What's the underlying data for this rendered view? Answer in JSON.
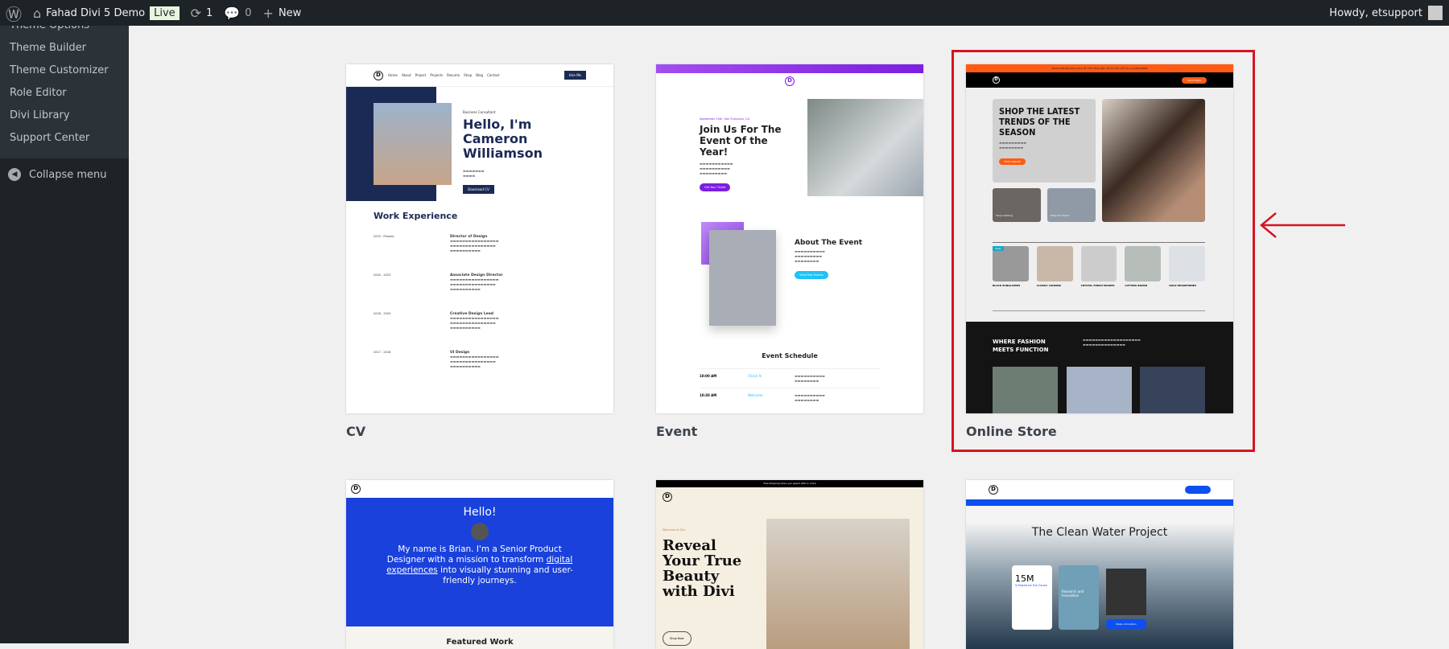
{
  "topbar": {
    "site_name": "Fahad Divi 5 Demo",
    "live_badge": "Live",
    "updates_count": "1",
    "comments_count": "0",
    "new_label": "New",
    "howdy": "Howdy, etsupport"
  },
  "sidebar": {
    "items": [
      "Theme Options",
      "Theme Builder",
      "Theme Customizer",
      "Role Editor",
      "Divi Library",
      "Support Center"
    ],
    "collapse": "Collapse menu"
  },
  "layouts": [
    {
      "label": "CV",
      "nav": [
        "Home",
        "About",
        "Project",
        "Projects",
        "Resume",
        "Shop",
        "Blog",
        "Contact"
      ],
      "button": "Hire Me",
      "eyebrow": "Business Consultant",
      "headline": "Hello, I'm Cameron Williamson",
      "cta": "Download CV",
      "section": "Work Experience",
      "jobs": [
        {
          "dates": "2023 - Present",
          "title": "Director of Design"
        },
        {
          "dates": "2020 - 2023",
          "title": "Associate Design Director"
        },
        {
          "dates": "2018 - 2020",
          "title": "Creative Design Lead"
        },
        {
          "dates": "2017 - 2018",
          "title": "UI Design"
        }
      ]
    },
    {
      "label": "Event",
      "eyebrow": "September 15th, San Francisco, CA",
      "headline": "Join Us For The Event Of the Year!",
      "cta": "Get Your Ticket",
      "about": "About The Event",
      "about_cta": "View Past Events",
      "schedule": "Event Schedule",
      "rows": [
        {
          "time": "10:00 AM",
          "name": "Check In"
        },
        {
          "time": "10:30 AM",
          "name": "Welcome"
        }
      ]
    },
    {
      "label": "Online Store",
      "banner": "Shop our biggest sale of the year get up to 50% off all accessories",
      "cta_top": "Shop Now",
      "headline": "Shop The Latest Trends Of The Season",
      "cta": "Shop Online",
      "tiles": [
        "Shop Clothing",
        "Shop For Home"
      ],
      "products": [
        "Black Sunglasses",
        "Classic Looking",
        "Crystal Finish Shades",
        "Cutting Board",
        "Gold Headphones"
      ],
      "sale": "Sale!",
      "section": "Where Fashion Meets Function"
    },
    {
      "hello": "Hello!",
      "intro": "My name is Brian. I'm a Senior Product Designer with a mission to transform",
      "link": "digital experiences",
      "intro2": "into visually stunning and user-friendly journeys.",
      "section": "Featured Work"
    },
    {
      "banner": "Free shipping when you spend $50 or more",
      "eyebrow": "Welcome to Divi",
      "headline": "Reveal Your True Beauty with Divi",
      "cta": "Shop Now"
    },
    {
      "headline": "The Clean Water Project",
      "stat": "15M",
      "stat_label": "$ Raised for the Cause",
      "card2": "Research and Innovation",
      "cta": "Make a Donation"
    }
  ],
  "colors": {
    "highlight": "#d7131f",
    "cv_navy": "#1b2a55",
    "event_purple": "#7b1fe0",
    "store_orange": "#ff5b14",
    "portfolio_blue": "#1a41dc"
  }
}
